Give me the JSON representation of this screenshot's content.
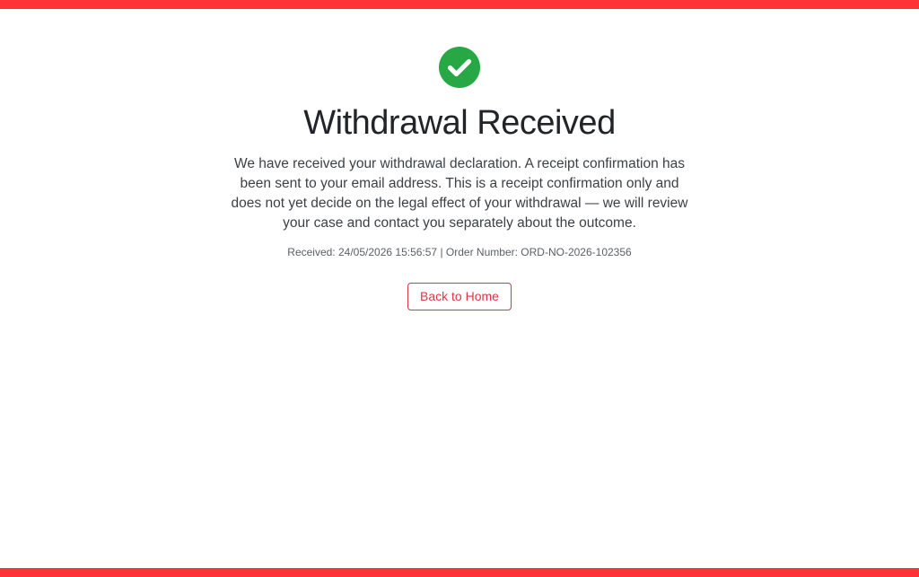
{
  "colors": {
    "accent_bar": "#fe3237",
    "success": "#28a745",
    "button_outline": "#dc3545"
  },
  "status_icon": "check-circle-icon",
  "heading": "Withdrawal Received",
  "message": "We have received your withdrawal declaration. A receipt confirmation has been sent to your email address. This is a receipt confirmation only and does not yet decide on the legal effect of your withdrawal — we will review your case and contact you separately about the outcome.",
  "meta": {
    "received_label": "Received:",
    "received_value": "24/05/2026 15:56:57",
    "separator": "|",
    "order_label": "Order Number:",
    "order_value": "ORD-NO-2026-102356"
  },
  "actions": {
    "back_home_label": "Back to Home"
  }
}
